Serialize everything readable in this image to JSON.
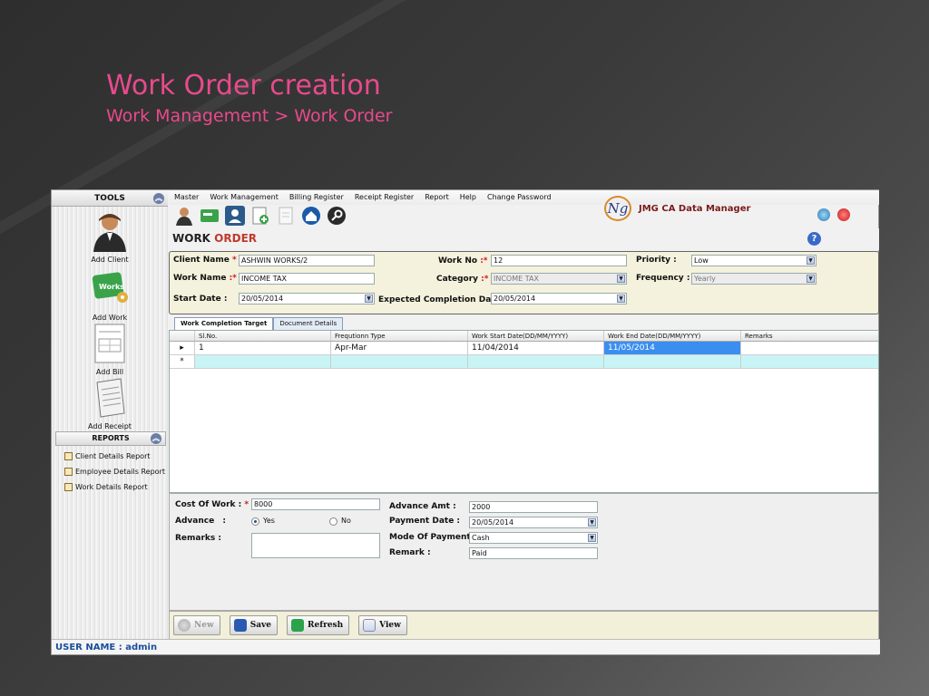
{
  "slide": {
    "title": "Work Order creation",
    "subtitle": "Work Management > Work Order"
  },
  "colors": {
    "accent": "#e84a8c",
    "brand": "#7a1a1a",
    "selection": "#3a8ef0",
    "new_row": "#c8f4f6",
    "required": "#d0121d"
  },
  "tools_panel": {
    "title": "TOOLS",
    "items": [
      {
        "label": "Add Client",
        "icon": "person-icon"
      },
      {
        "label": "Add Work",
        "icon": "works-icon"
      },
      {
        "label": "Add Bill",
        "icon": "bill-icon"
      },
      {
        "label": "Add Receipt",
        "icon": "receipt-icon"
      }
    ]
  },
  "reports_panel": {
    "title": "REPORTS",
    "items": [
      "Client Details Report",
      "Employee Details Report",
      "Work Details Report"
    ]
  },
  "menu": [
    "Master",
    "Work Management",
    "Billing Register",
    "Receipt Register",
    "Report",
    "Help",
    "Change Password"
  ],
  "brand": {
    "logo_text": "Ng",
    "name": "JMG CA Data Manager"
  },
  "page": {
    "title_part1": "WORK",
    "title_part2": "ORDER",
    "help_symbol": "?"
  },
  "form": {
    "client_name": {
      "label": "Client  Name",
      "req": "*",
      "value": "ASHWIN WORKS/2"
    },
    "work_no": {
      "label": "Work No",
      "req": ":*",
      "value": "12"
    },
    "priority": {
      "label": "Priority :",
      "value": "Low"
    },
    "work_name": {
      "label": "Work Name",
      "req": ":*",
      "value": "INCOME TAX"
    },
    "category": {
      "label": "Category",
      "req": ":*",
      "value": "INCOME TAX"
    },
    "frequency": {
      "label": "Frequency",
      "sep": ":",
      "value": "Yearly"
    },
    "start_date": {
      "label": "Start Date :",
      "value": "20/05/2014"
    },
    "expected_completion": {
      "label": "Expected Completion Date :",
      "value": "20/05/2014"
    }
  },
  "tabs": [
    "Work Completion Target",
    "Document Details"
  ],
  "grid": {
    "columns": [
      "Sl.No.",
      "Frequtionn Type",
      "Work Start Date(DD/MM/YYYY)",
      "Work End Date(DD/MM/YYYY)",
      "Remarks"
    ],
    "rows": [
      {
        "marker": "▸",
        "slno": "1",
        "freq": "Apr-Mar",
        "start": "11/04/2014",
        "end": "11/05/2014",
        "remarks": ""
      }
    ],
    "new_row_marker": "*"
  },
  "payment": {
    "cost_of_work": {
      "label": "Cost Of Work",
      "sep": ":",
      "req": "*",
      "value": "8000"
    },
    "advance": {
      "label": "Advance",
      "sep": ":",
      "yes": "Yes",
      "no": "No",
      "selected": "Yes"
    },
    "remarks": {
      "label": "Remarks :",
      "value": ""
    },
    "advance_amt": {
      "label": "Advance  Amt  :",
      "value": "2000"
    },
    "payment_date": {
      "label": "Payment Date  :",
      "value": "20/05/2014"
    },
    "mode_of_payment": {
      "label": "Mode Of Payment :",
      "value": "Cash"
    },
    "remark": {
      "label": "Remark :",
      "value": "Paid"
    }
  },
  "buttons": {
    "new": "New",
    "save": "Save",
    "refresh": "Refresh",
    "view": "View"
  },
  "status": {
    "user_label": "USER NAME :",
    "user": "admin"
  }
}
